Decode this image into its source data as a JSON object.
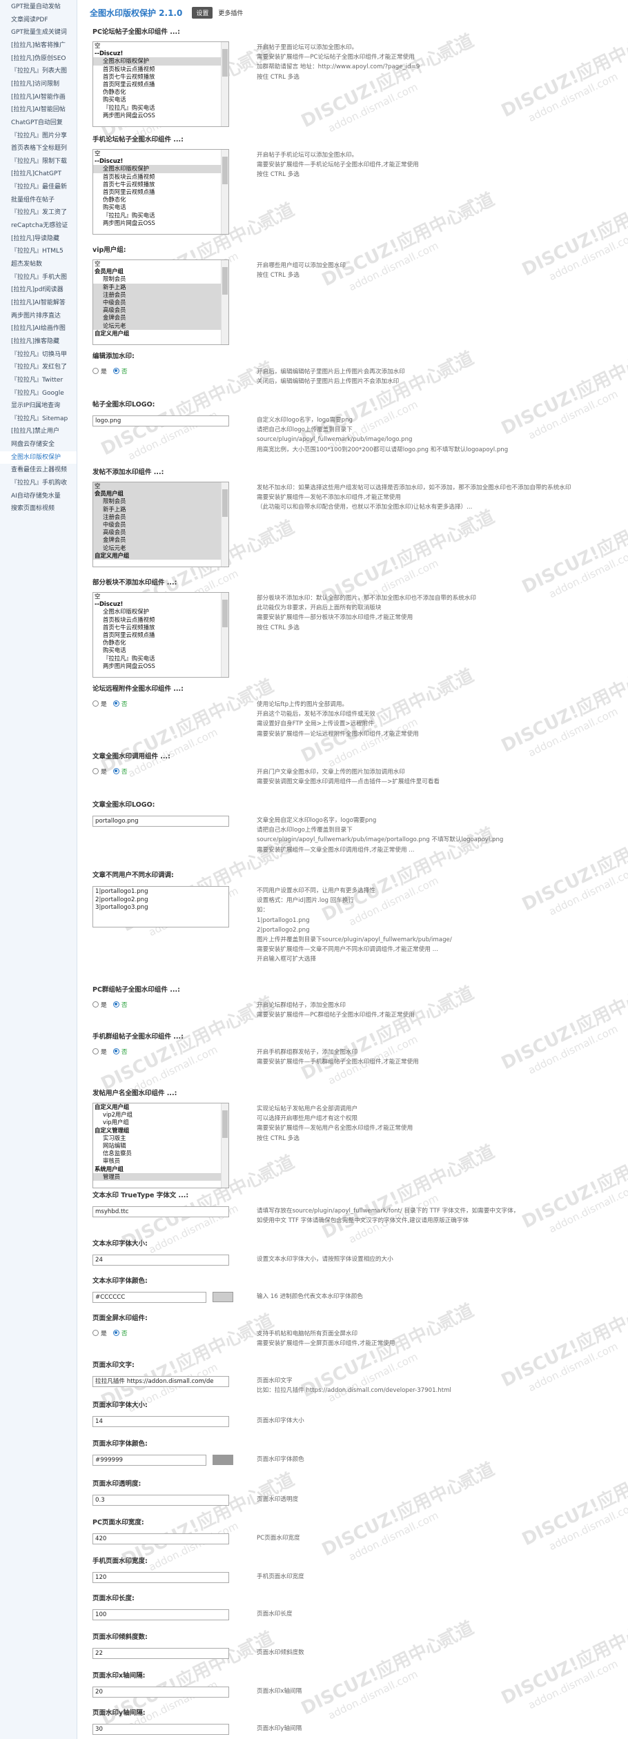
{
  "sidebar": {
    "items": [
      "GPT批量自动发帖",
      "文章阅读PDF",
      "GPT批量生成关键词",
      "[拉拉凡]帖客将推广",
      "[拉拉凡]伪原创SEO",
      "『拉拉凡』列表大图",
      "[拉拉凡]访问限制",
      "[拉拉凡]AI智能作画",
      "[拉拉凡]AI智能回帖",
      "ChatGPT自动回复",
      "『拉拉凡』图片分享",
      "首页表格下全标题列",
      "『拉拉凡』限制下载",
      "[拉拉凡]ChatGPT",
      "『拉拉凡』最佳最新",
      "批量组件在帖子",
      "『拉拉凡』发工资了",
      "reCaptcha无感验证",
      "[拉拉凡]导读隐藏",
      "『拉拉凡』HTML5",
      "超杰发帖数",
      "『拉拉凡』手机大图",
      "[拉拉凡]pdf阅读器",
      "[拉拉凡]AI智能解答",
      "两步图片排序直达",
      "[拉拉凡]AI绘画作图",
      "[拉拉凡]推客隐藏",
      "『拉拉凡』切换马甲",
      "『拉拉凡』发红包了",
      "『拉拉凡』Twitter",
      "『拉拉凡』Google",
      "显示IP归属地查询",
      "『拉拉凡』Sitemap",
      "[拉拉凡]禁止用户",
      "网盘云存储安全",
      "全图水印版权保护",
      "查看最佳云上器视频",
      "『拉拉凡』手机购收",
      "AI自动存储免水量",
      "搜索页面标视频"
    ],
    "active_index": 35
  },
  "header": {
    "title": "全图水印版权保护 2.1.0",
    "tab_settings": "设置",
    "tab_more": "更多插件"
  },
  "watermark": {
    "brand": "DISCUZ!应用中心",
    "sub": "贰道",
    "url": "addon.dismall.com"
  },
  "sections": [
    {
      "label": "PC论坛帖子全图水印组件 ...:",
      "type": "list",
      "options": [
        "空",
        "--Discuz!",
        "全图水印版权保护",
        "首页板块云点播视频",
        "首页七牛云视频播放",
        "首页阿里云视频点播",
        "伪静态化",
        "购买电话",
        "『拉拉凡』购买电话",
        "两步图片网盘云OSS"
      ],
      "selected": [
        2
      ],
      "groups": [
        1
      ],
      "desc": [
        "开启帖子里面论坛可以添加全图水印。",
        "需要安装扩展组件—PC论坛帖子全图水印组件,才能正常使用",
        "加群帮助请留言 地址：http://www.apoyl.com/?page_id=9",
        "按住 CTRL 多选"
      ]
    },
    {
      "label": "手机论坛帖子全图水印组件 ...:",
      "type": "list",
      "options": [
        "空",
        "--Discuz!",
        "全图水印版权保护",
        "首页板块云点播视频",
        "首页七牛云视频播放",
        "首页阿里云视频点播",
        "伪静态化",
        "购买电话",
        "『拉拉凡』购买电话",
        "两步图片网盘云OSS"
      ],
      "selected": [
        2
      ],
      "groups": [
        1
      ],
      "desc": [
        "开启帖子手机论坛可以添加全图水印。",
        "需要安装扩展组件—手机论坛帖子全图水印组件,才能正常使用",
        "按住 CTRL 多选"
      ]
    },
    {
      "label": "vip用户组:",
      "type": "list",
      "options": [
        "空",
        "会员用户组",
        "限制会员",
        "新手上路",
        "注册会员",
        "中级会员",
        "高级会员",
        "金牌会员",
        "论坛元老",
        "自定义用户组"
      ],
      "selected": [
        3,
        4,
        5,
        6,
        7,
        8
      ],
      "groups": [
        1,
        9
      ],
      "desc": [
        "开启哪些用户组可以添加全图水印",
        "按住 CTRL 多选"
      ]
    },
    {
      "label": "编辑添加水印:",
      "type": "radio",
      "opt_yes": "是",
      "opt_no": "否",
      "value": "no",
      "desc": [
        "开启后，编辑编辑帖子里图片后上传图片会再次添加水印",
        "关闭后，编辑编辑帖子里图片后上传图片不会添加水印"
      ]
    },
    {
      "label": "帖子全图水印LOGO:",
      "type": "text",
      "value": "logo.png",
      "desc": [
        "自定义水印logo名字，logo需要png",
        "请把自己水印logo上传覆盖到目录下",
        "source/plugin/apoyl_fullwemark/pub/image/logo.png",
        "用高宽比例，大小范围100*100到200*200都可以请帮logo.png 和不填写默认logoapoyl.png"
      ]
    },
    {
      "label": "发帖不添加水印组件 ...:",
      "type": "list",
      "options": [
        "空",
        "会员用户组",
        "限制会员",
        "新手上路",
        "注册会员",
        "中级会员",
        "高级会员",
        "金牌会员",
        "论坛元老",
        "自定义用户组"
      ],
      "selected": [
        0,
        1,
        2,
        3,
        4,
        5,
        6,
        7,
        8,
        9
      ],
      "groups": [
        1,
        9
      ],
      "desc": [
        "发帖不加水印：如果选择这些用户组发帖可以选择是否添加水印，如不添加，那不添加全图水印也不添加自带的系统水印",
        "需要安装扩展组件—发帖不添加水印组件,才能正常使用",
        "（此功能可以和自带水印配合使用，也就以不添加全图水印)让帖水有更多选择）..."
      ]
    },
    {
      "label": "部分板块不添加水印组件 ...:",
      "type": "list",
      "options": [
        "空",
        "--Discuz!",
        "全图水印版权保护",
        "首页板块云点播视频",
        "首页七牛云视频播放",
        "首页阿里云视频点播",
        "伪静态化",
        "购买电话",
        "『拉拉凡』购买电话",
        "两步图片网盘云OSS"
      ],
      "selected": [],
      "groups": [
        1
      ],
      "desc": [
        "部分板块不添加水印：默认全部的图片，那不添加全图水印也不添加自带的系统水印",
        "此功能仅为非要求，开启后上面所有的取消版块",
        "需要安装扩展组件—部分板块不添加水印组件,才能正常使用",
        "按住 CTRL 多选"
      ]
    },
    {
      "label": "论坛远程附件全图水印组件 ...:",
      "type": "radio",
      "opt_yes": "是",
      "opt_no": "否",
      "value": "no",
      "desc": [
        "使用论坛ftp上传的图片全部调用。",
        "开启这个功能后，发帖不添加水印组件或无效",
        "需设置好自身FTP 全局>上传设置>远程附件",
        "需要安装扩展组件—论坛远程附件全图水印组件,才能正常使用"
      ]
    },
    {
      "label": "文章全图水印调用组件 ...:",
      "type": "radio",
      "opt_yes": "是",
      "opt_no": "否",
      "value": "no",
      "desc": [
        "开启门户文章全图水印，文章上传的图片加添加调用水印",
        "需要安装调图文章全图水印调用组件—点击插件—>扩展组件里可看看"
      ]
    },
    {
      "label": "文章全图水印LOGO:",
      "type": "text",
      "value": "portallogo.png",
      "desc": [
        "文章全局自定义水印logo名字，logo需要png",
        "请把自己水印logo上传覆盖到目录下",
        "source/plugin/apoyl_fullwemark/pub/image/portallogo.png 不填写默认logoapoyl.png",
        "需要安装扩展组件—文章全图水印调用组件,才能正常使用 ..."
      ]
    },
    {
      "label": "文章不同用户不同水印调调:",
      "type": "textarea",
      "lines": [
        "1|portallogo1.png",
        "2|portallogo2.png",
        "3|portallogo3.png"
      ],
      "desc": [
        "不同用户设置水印不同，让用户有更多选择性",
        "设置格式：用户id|图片.log 回车换行",
        "如：",
        "1|portallogo1.png",
        "2|portallogo2.png",
        "图片上传并覆盖到目录下source/plugin/apoyl_fullwemark/pub/image/",
        "需要安装扩展组件—文章不同用户不同水印调调组件,才能正常使用 ...",
        "开启输入框可扩大选择"
      ]
    },
    {
      "label": "PC群组帖子全图水印组件 ...:",
      "type": "radio",
      "opt_yes": "是",
      "opt_no": "否",
      "value": "no",
      "desc": [
        "开启论坛群组帖子，添加全图水印",
        "需要安装扩展组件—PC群组帖子全图水印组件,才能正常使用"
      ]
    },
    {
      "label": "手机群组帖子全图水印组件 ...:",
      "type": "radio",
      "opt_yes": "是",
      "opt_no": "否",
      "value": "no",
      "desc": [
        "开启手机群组群发帖子，添加全图水印",
        "需要安装扩展组件—手机群组帖子全图水印组件,才能正常使用"
      ]
    },
    {
      "label": "发帖用户名全图水印组件 ...:",
      "type": "list",
      "options": [
        "自定义用户组",
        "vip2用户组",
        "vip用户组",
        "自定义管理组",
        "实习版主",
        "网站编辑",
        "信息监察员",
        "审核员",
        "系统用户组",
        "管理员"
      ],
      "selected": [
        9
      ],
      "groups": [
        0,
        3,
        8
      ],
      "desc": [
        "实现论坛帖子发帖用户名全部调调用户",
        "可以选择开启哪些用户组才有这个权限",
        "需要安装扩展组件—发帖用户名全图水印组件,才能正常使用",
        "按住 CTRL 多选"
      ]
    },
    {
      "label": "文本水印 TrueType 字体文 ...:",
      "type": "text",
      "value": "msyhbd.ttc",
      "desc": [
        "请填写存放在source/plugin/apoyl_fullwemark/font/ 目录下的 TTF 字体文件，如需要中文字体，",
        "如使用中文 TTF 字体请确保包含完整中文汉字的字体文件,建议请用原版正确字体"
      ]
    },
    {
      "label": "文本水印字体大小:",
      "type": "text",
      "value": "24",
      "desc": [
        "设置文本水印字体大小，请按照字体设置相应的大小"
      ]
    },
    {
      "label": "文本水印字体颜色:",
      "type": "color",
      "value": "#CCCCCC",
      "desc": [
        "输入 16 进制颜色代表文本水印字体颜色"
      ]
    },
    {
      "label": "页面全屏水印组件:",
      "type": "radio",
      "opt_yes": "是",
      "opt_no": "否",
      "value": "no",
      "desc": [
        "支持手机帖和电脑帖所有页面全屏水印",
        "需要安装扩展组件—全屏页面水印组件,才能正常使用"
      ]
    },
    {
      "label": "页面水印文字:",
      "type": "text",
      "value": "拉拉凡插件 https://addon.dismall.com/de",
      "desc": [
        "页面水印文字",
        "比如：拉拉凡插件 https://addon.dismall.com/developer-37901.html"
      ]
    },
    {
      "label": "页面水印字体大小:",
      "type": "text",
      "value": "14",
      "desc": [
        "页面水印字体大小"
      ]
    },
    {
      "label": "页面水印字体颜色:",
      "type": "color",
      "value": "#999999",
      "desc": [
        "页面水印字体颜色"
      ]
    },
    {
      "label": "页面水印透明度:",
      "type": "text",
      "value": "0.3",
      "desc": [
        "页面水印透明度"
      ]
    },
    {
      "label": "PC页面水印宽度:",
      "type": "text",
      "value": "420",
      "desc": [
        "PC页面水印宽度"
      ]
    },
    {
      "label": "手机页面水印宽度:",
      "type": "text",
      "value": "120",
      "desc": [
        "手机页面水印宽度"
      ]
    },
    {
      "label": "页面水印长度:",
      "type": "text",
      "value": "100",
      "desc": [
        "页面水印长度"
      ]
    },
    {
      "label": "页面水印倾斜度数:",
      "type": "text",
      "value": "22",
      "desc": [
        "页面水印倾斜度数"
      ]
    },
    {
      "label": "页面水印x轴间隔:",
      "type": "text",
      "value": "20",
      "desc": [
        "页面水印x轴间隔"
      ]
    },
    {
      "label": "页面水印y轴间隔:",
      "type": "text",
      "value": "30",
      "desc": [
        "页面水印y轴间隔"
      ]
    }
  ]
}
